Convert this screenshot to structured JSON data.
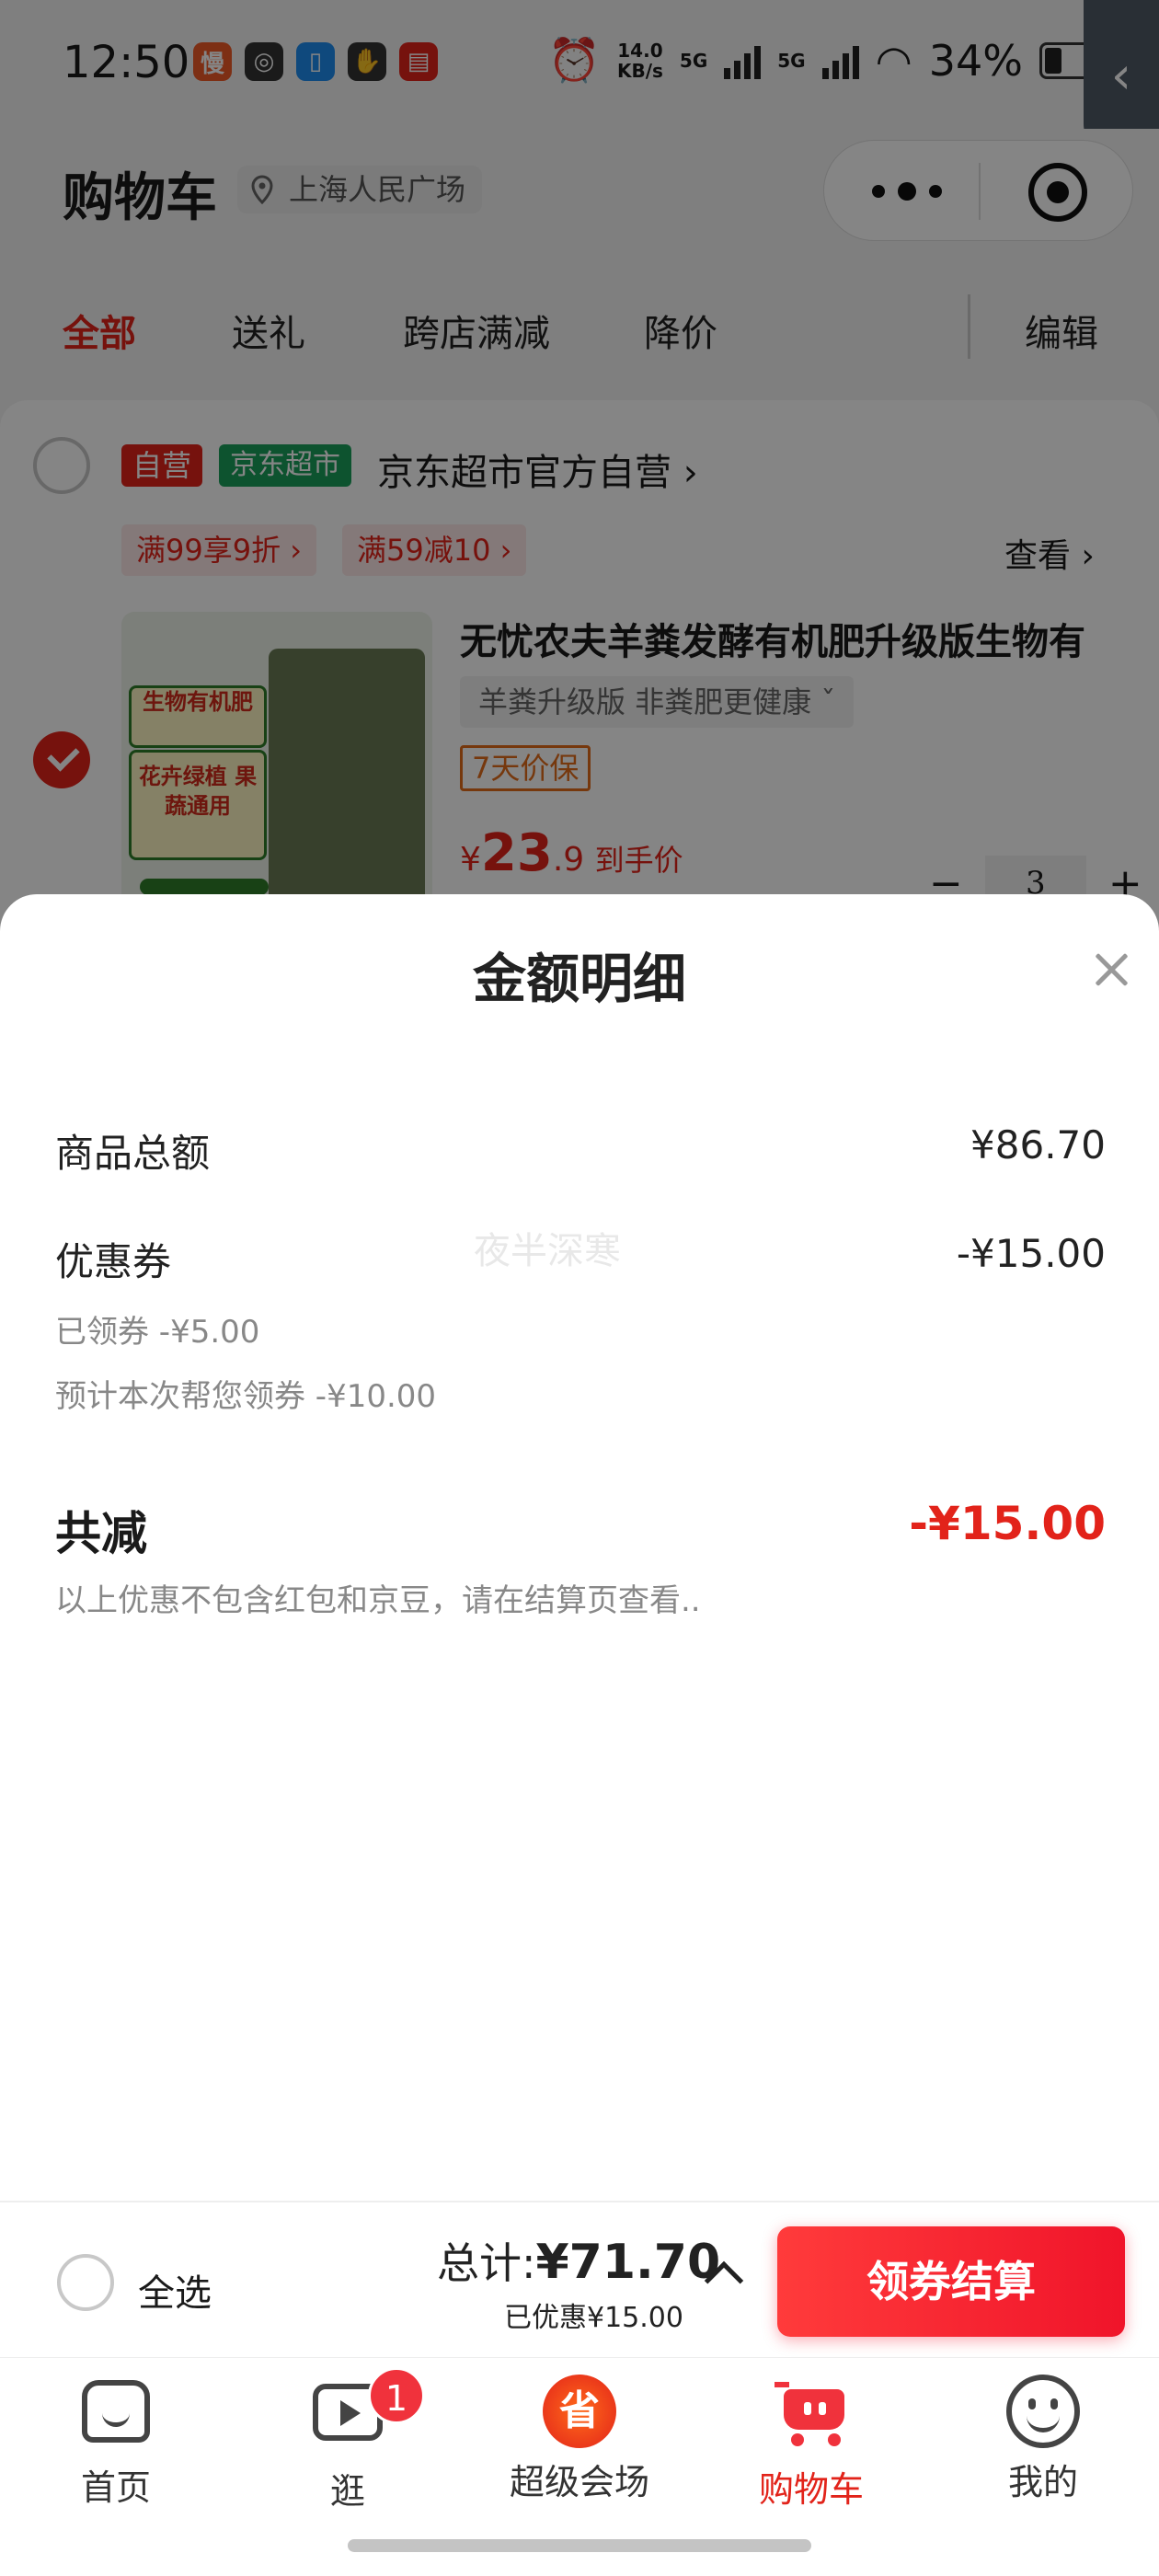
{
  "status": {
    "time": "12:50",
    "net_speed": "14.0",
    "net_unit": "KB/s",
    "net1": "5G",
    "net2": "5G",
    "battery": "34%"
  },
  "header": {
    "title": "购物车",
    "location": "上海人民广场"
  },
  "tabs": [
    "全部",
    "送礼",
    "跨店满减",
    "降价"
  ],
  "edit_label": "编辑",
  "store": {
    "tag_self": "自营",
    "tag_market": "京东超市",
    "name": "京东超市官方自营 ›",
    "promos": [
      "满99享9折 ›",
      "满59减10 ›"
    ],
    "view_all": "查看 ›"
  },
  "product": {
    "title": "无忧农夫羊粪发酵有机肥升级版生物有",
    "spec": "羊粪升级版 非粪肥更健康  ˇ",
    "guarantee": "7天价保",
    "price_symbol": "¥",
    "price_int": "23",
    "price_dec": ".9",
    "price_note": "到手价",
    "quantity": "3",
    "image_label_1": "生物有机肥",
    "image_label_2": "花卉绿植 果蔬通用"
  },
  "sheet": {
    "title": "金额明细",
    "watermark": "夜半深寒",
    "goods_label": "商品总额",
    "goods_value": "¥86.70",
    "coupon_label": "优惠券",
    "coupon_value": "-¥15.00",
    "coupon_claimed": "已领券 -¥5.00",
    "coupon_auto": "预计本次帮您领券 -¥10.00",
    "total_off_label": "共减",
    "total_off_value": "-¥15.00",
    "note": "以上优惠不包含红包和京豆，请在结算页查看.."
  },
  "checkout": {
    "select_all": "全选",
    "total_label": "总计:",
    "total_value": "¥71.70",
    "saved": "已优惠¥15.00",
    "button": "领券结算"
  },
  "tabbar": {
    "items": [
      {
        "label": "首页",
        "icon": "home-icon"
      },
      {
        "label": "逛",
        "icon": "video-icon",
        "badge": "1"
      },
      {
        "label": "超级会场",
        "icon": "super-venue-icon",
        "glyph": "省"
      },
      {
        "label": "购物车",
        "icon": "cart-icon"
      },
      {
        "label": "我的",
        "icon": "profile-icon"
      }
    ]
  },
  "colors": {
    "accent": "#e2231a",
    "market_green": "#19a05b"
  }
}
